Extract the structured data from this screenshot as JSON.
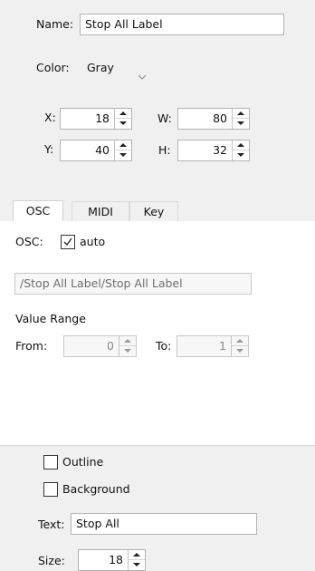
{
  "top": {
    "name_label": "Name:",
    "name_value": "Stop All Label",
    "color_label": "Color:",
    "color_value": "Gray",
    "x_label": "X:",
    "x_value": "18",
    "w_label": "W:",
    "w_value": "80",
    "y_label": "Y:",
    "y_value": "40",
    "h_label": "H:",
    "h_value": "32"
  },
  "tabs": [
    {
      "label": "OSC",
      "active": true
    },
    {
      "label": "MIDI",
      "active": false
    },
    {
      "label": "Key",
      "active": false
    }
  ],
  "osc": {
    "osc_label": "OSC:",
    "auto_label": "auto",
    "auto_checked": true,
    "address_value": "/Stop All Label/Stop All Label",
    "value_range_label": "Value Range",
    "from_label": "From:",
    "from_value": "0",
    "to_label": "To:",
    "to_value": "1"
  },
  "bottom": {
    "outline_label": "Outline",
    "outline_checked": false,
    "background_label": "Background",
    "background_checked": false,
    "text_label": "Text:",
    "text_value": "Stop All",
    "size_label": "Size:",
    "size_value": "18"
  },
  "icons": {
    "dropdown": "chevron-down-icon",
    "check": "checkmark-icon",
    "spin_up": "spin-up-icon",
    "spin_down": "spin-down-icon"
  }
}
